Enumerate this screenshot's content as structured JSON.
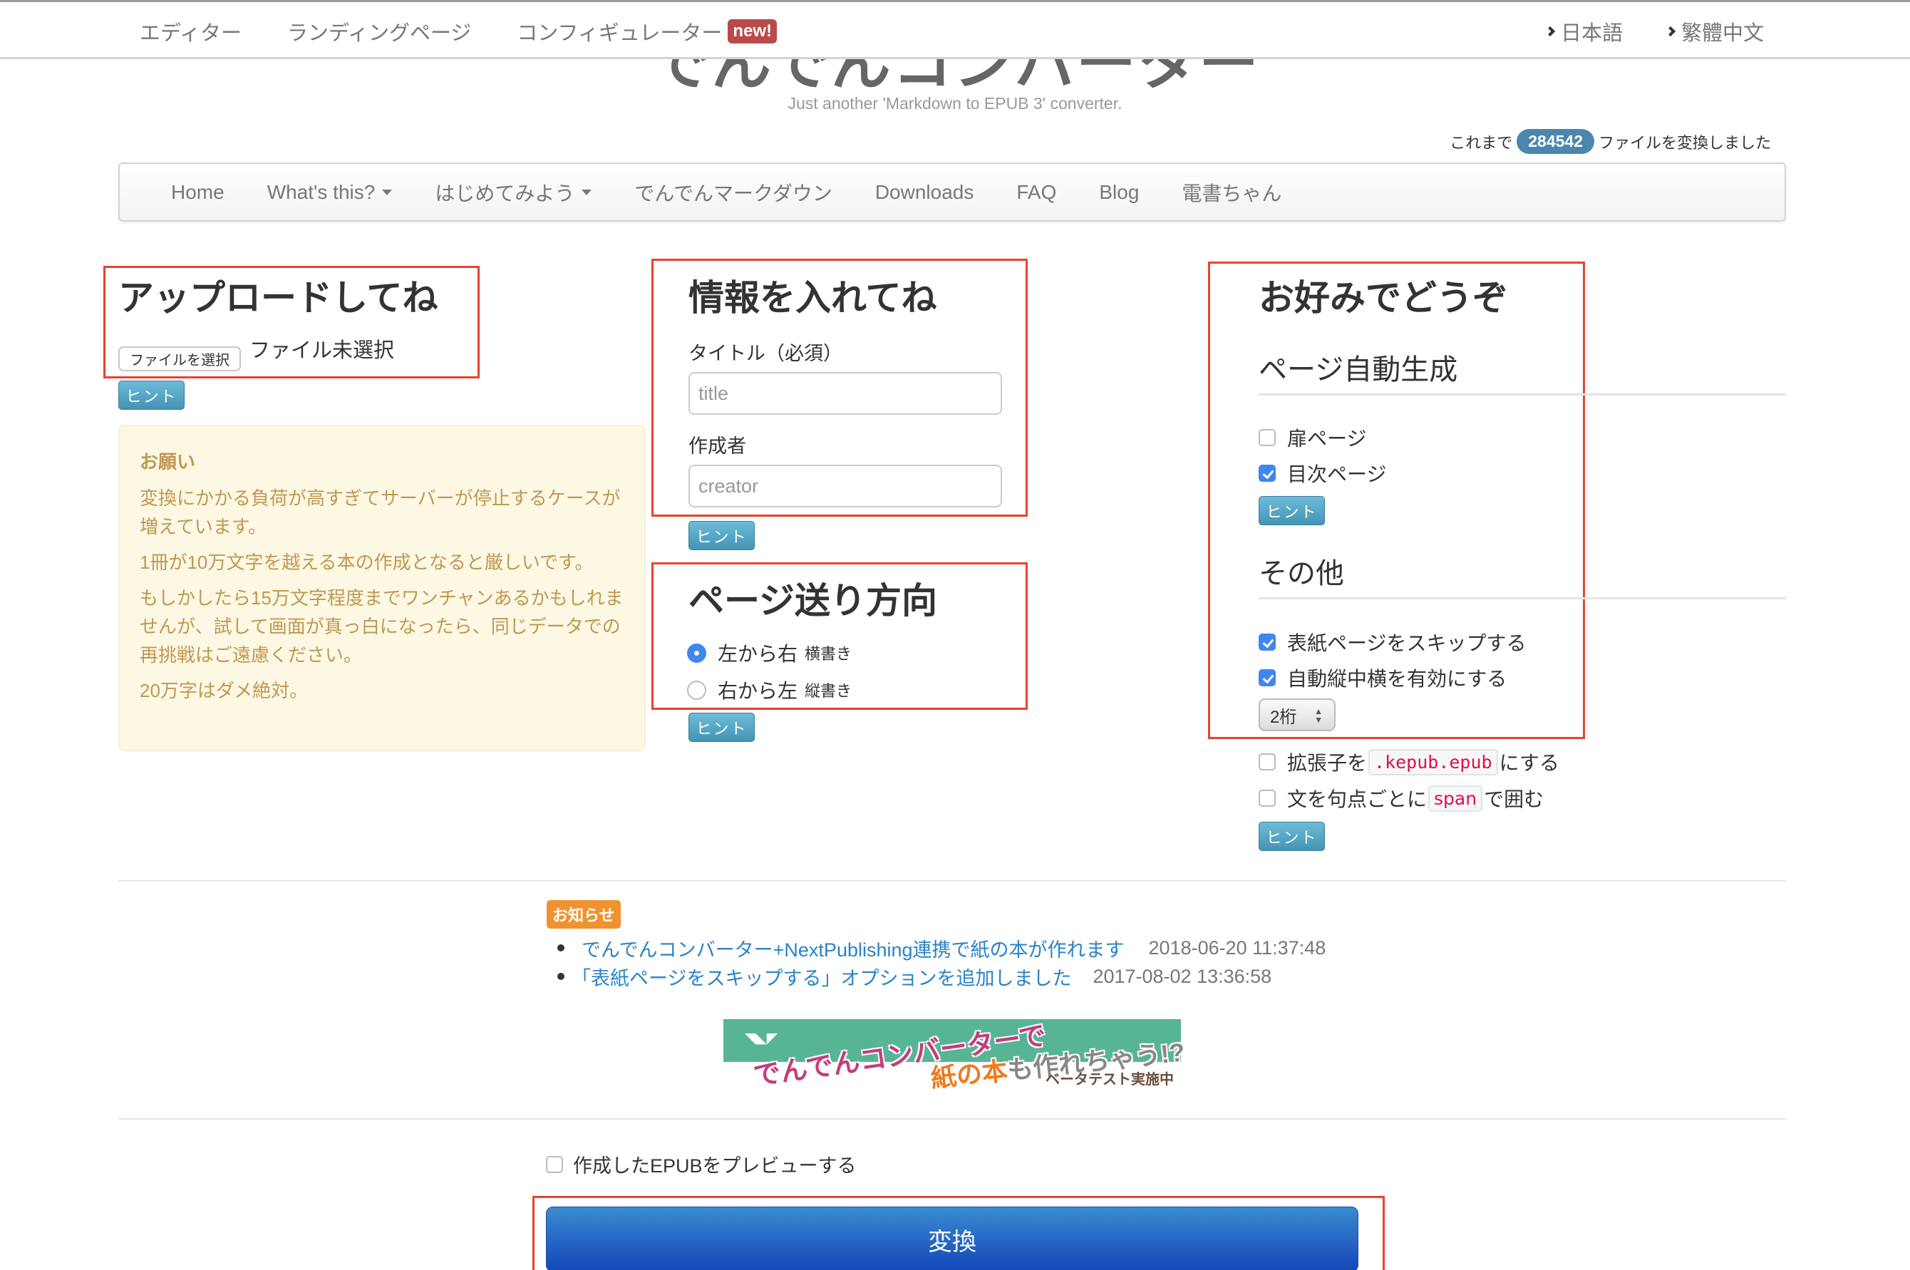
{
  "topbar": {
    "links": [
      {
        "label": "エディター"
      },
      {
        "label": "ランディングページ"
      },
      {
        "label": "コンフィギュレーター",
        "badge": "new!"
      }
    ],
    "languages": [
      {
        "label": "日本語"
      },
      {
        "label": "繁體中文"
      }
    ]
  },
  "site": {
    "title": "でんでんコンバーター",
    "tagline": "Just another 'Markdown to EPUB 3' converter.",
    "counter_prefix": "これまで",
    "counter_value": "284542",
    "counter_suffix": "ファイルを変換しました"
  },
  "navbar": {
    "items": [
      {
        "label": "Home",
        "dropdown": false
      },
      {
        "label": "What's this?",
        "dropdown": true
      },
      {
        "label": "はじめてみよう",
        "dropdown": true
      },
      {
        "label": "でんでんマークダウン",
        "dropdown": false
      },
      {
        "label": "Downloads",
        "dropdown": false
      },
      {
        "label": "FAQ",
        "dropdown": false
      },
      {
        "label": "Blog",
        "dropdown": false
      },
      {
        "label": "電書ちゃん",
        "dropdown": false
      }
    ]
  },
  "hint_label": "ヒント",
  "upload": {
    "heading": "アップロードしてね",
    "file_button": "ファイルを選択",
    "file_status": "ファイル未選択"
  },
  "warning": {
    "title": "お願い",
    "paragraphs": [
      "変換にかかる負荷が高すぎてサーバーが停止するケースが増えています。",
      "1冊が10万文字を越える本の作成となると厳しいです。",
      "もしかしたら15万文字程度までワンチャンあるかもしれませんが、試して画面が真っ白になったら、同じデータでの再挑戦はご遠慮ください。",
      "20万字はダメ絶対。"
    ]
  },
  "info": {
    "heading": "情報を入れてね",
    "title_label": "タイトル（必須）",
    "title_placeholder": "title",
    "title_value": "",
    "creator_label": "作成者",
    "creator_placeholder": "creator",
    "creator_value": ""
  },
  "direction": {
    "heading": "ページ送り方向",
    "options": [
      {
        "label": "左から右",
        "sub": "横書き",
        "selected": true
      },
      {
        "label": "右から左",
        "sub": "縦書き",
        "selected": false
      }
    ]
  },
  "options": {
    "heading": "お好みでどうぞ",
    "autogen": {
      "heading": "ページ自動生成",
      "items": [
        {
          "label": "扉ページ",
          "checked": false
        },
        {
          "label": "目次ページ",
          "checked": true
        }
      ]
    },
    "other": {
      "heading": "その他",
      "items": [
        {
          "label": "表紙ページをスキップする",
          "checked": true
        },
        {
          "label": "自動縦中横を有効にする",
          "checked": true
        }
      ],
      "digits_select": {
        "value": "2桁"
      },
      "kepub": {
        "prefix": "拡張子を",
        "code": ".kepub.epub",
        "suffix": "にする",
        "checked": false
      },
      "span": {
        "prefix": "文を句点ごとに",
        "code": "span",
        "suffix": "で囲む",
        "checked": false
      }
    }
  },
  "notices": {
    "badge": "お知らせ",
    "items": [
      {
        "text": "でんでんコンバーター+NextPublishing連携で紙の本が作れます",
        "timestamp": "2018-06-20 11:37:48"
      },
      {
        "text": "「表紙ページをスキップする」オプションを追加しました",
        "timestamp": "2017-08-02 13:36:58"
      }
    ]
  },
  "banner": {
    "line1": "でんでんコンバーターで",
    "line2_highlight": "紙の本",
    "line2_rest": "も作れちゃう!?",
    "beta": "ベータテスト実施中"
  },
  "preview": {
    "label": "作成したEPUBをプレビューする",
    "checked": false
  },
  "convert_button": "変換",
  "colors": {
    "annotation_red": "#e8432e",
    "hint_blue": "#4b9fc2",
    "convert_blue": "#1e5fc4",
    "badge_new": "#b94a48",
    "notice_orange": "#f0932f",
    "link_blue": "#2a83c6",
    "warning_text": "#c09853"
  }
}
